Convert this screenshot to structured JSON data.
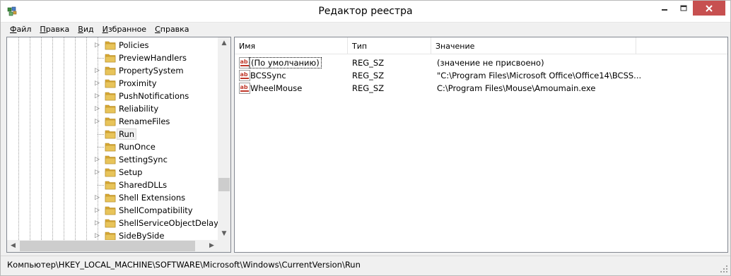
{
  "window": {
    "title": "Редактор реестра"
  },
  "menu": [
    {
      "label_u": "Ф",
      "label_rest": "айл"
    },
    {
      "label_u": "П",
      "label_rest": "равка"
    },
    {
      "label_u": "В",
      "label_rest": "ид"
    },
    {
      "label_u": "И",
      "label_rest": "збранное"
    },
    {
      "label_u": "С",
      "label_rest": "правка"
    }
  ],
  "tree": {
    "items": [
      {
        "label": "Policies",
        "expandable": true
      },
      {
        "label": "PreviewHandlers",
        "expandable": false
      },
      {
        "label": "PropertySystem",
        "expandable": true
      },
      {
        "label": "Proximity",
        "expandable": true
      },
      {
        "label": "PushNotifications",
        "expandable": true
      },
      {
        "label": "Reliability",
        "expandable": true
      },
      {
        "label": "RenameFiles",
        "expandable": true
      },
      {
        "label": "Run",
        "expandable": false,
        "selected": true
      },
      {
        "label": "RunOnce",
        "expandable": false
      },
      {
        "label": "SettingSync",
        "expandable": true
      },
      {
        "label": "Setup",
        "expandable": true
      },
      {
        "label": "SharedDLLs",
        "expandable": false
      },
      {
        "label": "Shell Extensions",
        "expandable": true
      },
      {
        "label": "ShellCompatibility",
        "expandable": true
      },
      {
        "label": "ShellServiceObjectDelayLo",
        "expandable": true
      },
      {
        "label": "SideBySide",
        "expandable": true
      }
    ]
  },
  "list": {
    "columns": {
      "name": "Имя",
      "type": "Тип",
      "value": "Значение"
    },
    "rows": [
      {
        "name": "(По умолчанию)",
        "type": "REG_SZ",
        "value": "(значение не присвоено)",
        "focused": true
      },
      {
        "name": "BCSSync",
        "type": "REG_SZ",
        "value": "\"C:\\Program Files\\Microsoft Office\\Office14\\BCSS..."
      },
      {
        "name": "WheelMouse",
        "type": "REG_SZ",
        "value": "C:\\Program Files\\Mouse\\Amoumain.exe"
      }
    ]
  },
  "status": {
    "path": "Компьютер\\HKEY_LOCAL_MACHINE\\SOFTWARE\\Microsoft\\Windows\\CurrentVersion\\Run"
  },
  "colors": {
    "close_button": "#c75050",
    "folder": "#e8c45a",
    "string_icon_red": "#c0392b"
  },
  "icons": {
    "app": "regedit-icon",
    "folder": "folder-icon",
    "value": "string-value-icon"
  }
}
